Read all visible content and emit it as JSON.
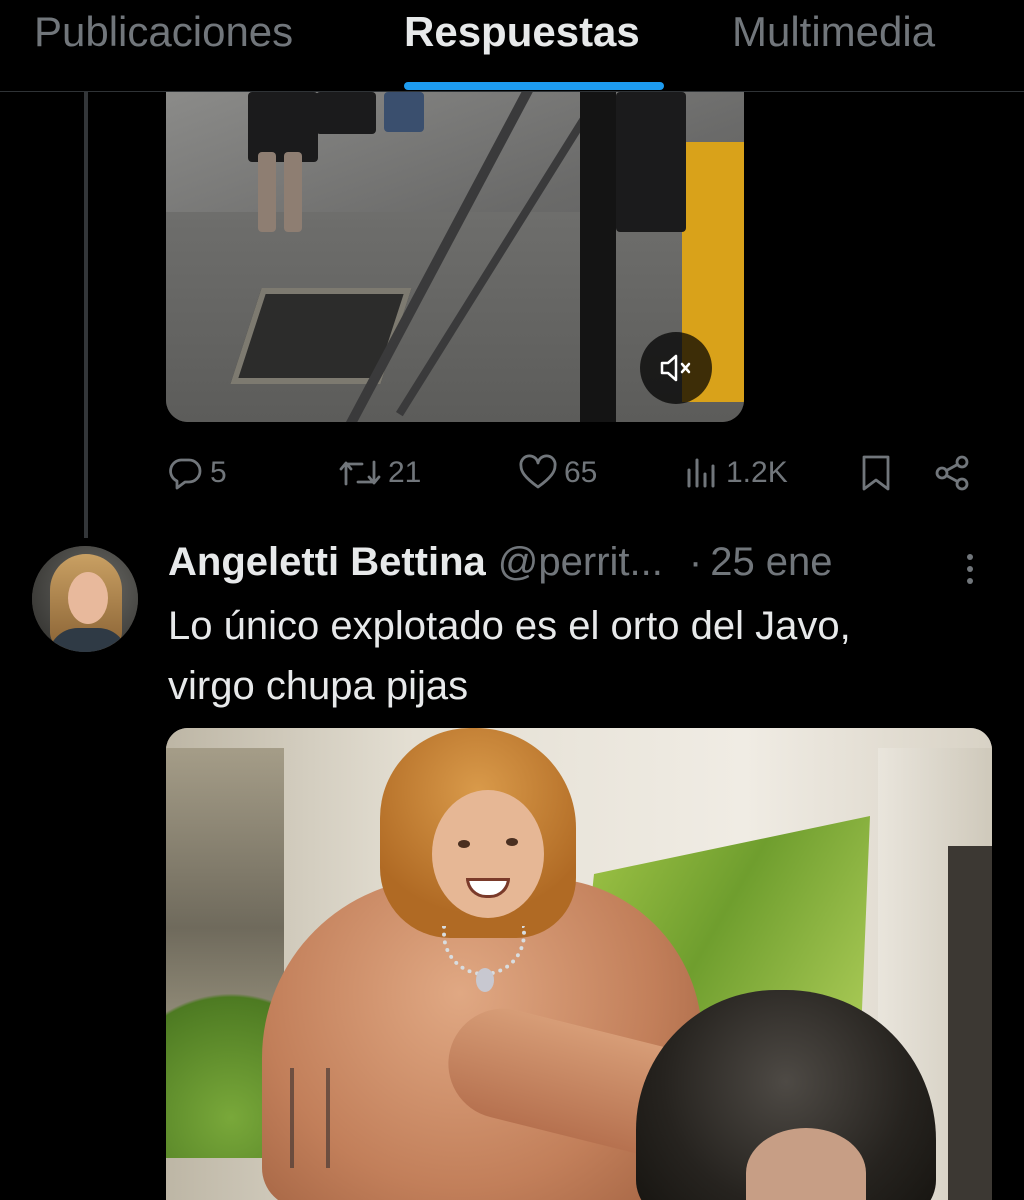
{
  "tabs": [
    {
      "label": "Publicaciones",
      "active": false
    },
    {
      "label": "Respuestas",
      "active": true
    },
    {
      "label": "Multimedia",
      "active": false
    }
  ],
  "colors": {
    "accent": "#1d9bf0",
    "background": "#000000",
    "text_primary": "#e7e9ea",
    "text_secondary": "#71767b"
  },
  "post_media": {
    "mute_icon": "volume-muted-icon"
  },
  "post_actions": {
    "replies": "5",
    "reposts": "21",
    "likes": "65",
    "views": "1.2K",
    "icons": [
      "reply-icon",
      "repost-icon",
      "like-icon",
      "views-icon",
      "bookmark-icon",
      "share-icon"
    ]
  },
  "reply": {
    "author_name": "Angeletti Bettina",
    "handle": "@perrit...",
    "separator": "·",
    "date": "25 ene",
    "text_line1": "Lo único explotado es el orto del Javo,",
    "text_line2": "virgo chupa pijas"
  }
}
